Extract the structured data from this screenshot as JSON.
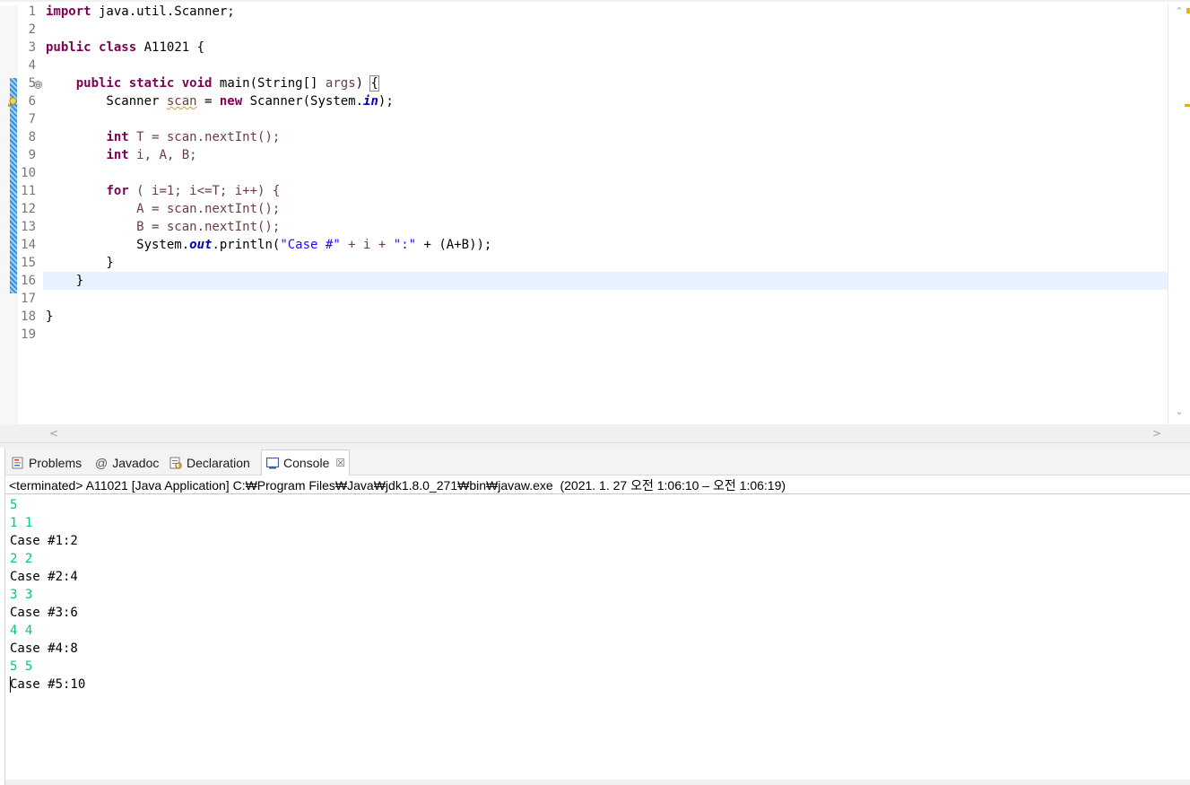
{
  "editor": {
    "line_numbers": [
      "1",
      "2",
      "3",
      "4",
      "5",
      "6",
      "7",
      "8",
      "9",
      "10",
      "11",
      "12",
      "13",
      "14",
      "15",
      "16",
      "17",
      "18",
      "19"
    ],
    "fold_icon_glyph": "⊖",
    "warning_icon": "lightbulb-warning-icon",
    "code": {
      "line1": {
        "kw": "import",
        "rest": " java.util.Scanner;"
      },
      "line3": {
        "kw1": "public",
        "kw2": "class",
        "rest": " A11021 {"
      },
      "line5": {
        "indent": "    ",
        "kw1": "public",
        "kw2": "static",
        "kw3": "void",
        "rest": " main(String[] ",
        "param": "args",
        "tail": ") ",
        "brace": "{"
      },
      "line6": {
        "pre": "        Scanner ",
        "var": "scan",
        "mid": " = ",
        "kw": "new",
        "rest": " Scanner(System.",
        "sfield": "in",
        "tail": ");"
      },
      "line8": {
        "indent": "        ",
        "kw": "int",
        "rest": " T = scan.nextInt();"
      },
      "line9": {
        "indent": "        ",
        "kw": "int",
        "rest": " i, A, B;"
      },
      "line11": {
        "indent": "        ",
        "kw": "for",
        "rest": " ( i=1; i<=T; i++) {"
      },
      "line12": "            A = scan.nextInt();",
      "line13": "            B = scan.nextInt();",
      "line14": {
        "pre": "            System.",
        "sfield": "out",
        "mid": ".println(",
        "s1": "\"Case #\"",
        "m2": " + i + ",
        "s2": "\":\"",
        "tail": " + (A+B));"
      },
      "line15": "        }",
      "line16": "    }",
      "line18": "}"
    },
    "scroll_up_glyph": "⌃",
    "scroll_down_glyph": "⌄",
    "scroll_left_glyph": "<",
    "scroll_right_glyph": ">"
  },
  "panel": {
    "tabs": [
      {
        "label": "Problems",
        "icon": "problems-icon"
      },
      {
        "label": "Javadoc",
        "icon": "at-sign-icon",
        "glyph": "@"
      },
      {
        "label": "Declaration",
        "icon": "declaration-icon"
      },
      {
        "label": "Console",
        "icon": "console-icon",
        "close": "☒"
      }
    ],
    "status": "<terminated> A11021 [Java Application] C:₩Program Files₩Java₩jdk1.8.0_271₩bin₩javaw.exe  (2021. 1. 27 오전 1:06:10 – 오전 1:06:19)",
    "output": [
      {
        "text": "5",
        "kind": "input"
      },
      {
        "text": "1 1",
        "kind": "input"
      },
      {
        "text": "Case #1:2",
        "kind": "stdout"
      },
      {
        "text": "2 2",
        "kind": "input"
      },
      {
        "text": "Case #2:4",
        "kind": "stdout"
      },
      {
        "text": "3 3",
        "kind": "input"
      },
      {
        "text": "Case #3:6",
        "kind": "stdout"
      },
      {
        "text": "4 4",
        "kind": "input"
      },
      {
        "text": "Case #4:8",
        "kind": "stdout"
      },
      {
        "text": "5 5",
        "kind": "input"
      },
      {
        "text": "Case #5:10",
        "kind": "stdout"
      }
    ]
  },
  "colors": {
    "keyword": "#7f0055",
    "string": "#2a00ff",
    "field": "#0000c0",
    "console_input": "#00c87d",
    "current_line": "#e8f2fe"
  }
}
